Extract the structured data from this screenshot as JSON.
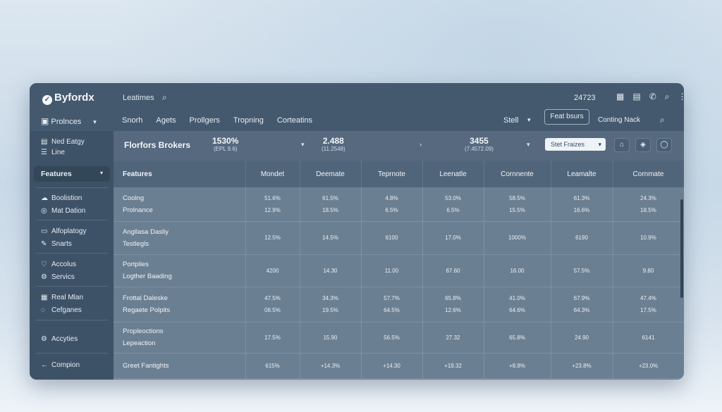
{
  "app": {
    "brand": "Byfordx",
    "search_label": "Leatimes",
    "clock": "24723"
  },
  "nav": {
    "products_label": "Prolnces",
    "tabs": [
      "Snorh",
      "Agets",
      "Prollgers",
      "Tropning",
      "Corteatins"
    ],
    "stell_label": "Stell",
    "features_button": "Feat bsurs",
    "coming_label": "Conting Nack"
  },
  "sidebar": {
    "items_top": [
      "Ned Eatgy",
      "Line"
    ],
    "active": "Features",
    "groups": [
      [
        "Boolistion",
        "Mat Dation"
      ],
      [
        "Alfoplatogy",
        "Snarts"
      ],
      [
        "Accolus",
        "Servics"
      ],
      [
        "Real Mlan",
        "Cefganes"
      ],
      [
        "Accyties"
      ]
    ],
    "footer": "Compion"
  },
  "summary": {
    "title": "Florfors Brokers",
    "stats": [
      {
        "value": "1530%",
        "sub": "(EPL 9.6)"
      },
      {
        "value": "2.488",
        "sub": "(11.2548)"
      },
      {
        "value": "3455",
        "sub": "(7.4572.09)"
      }
    ],
    "select_label": "Stet Fraizes"
  },
  "table": {
    "header_first": "Features",
    "columns": [
      "Mondet",
      "Deemate",
      "Teprnote",
      "Leenatle",
      "Cornnente",
      "Leamalte",
      "Cornmate"
    ],
    "rows": [
      {
        "labels": [
          "Coolng",
          "Prolnance"
        ],
        "values": [
          [
            "51.6%",
            "12.9%"
          ],
          [
            "61.5%",
            "18.5%"
          ],
          [
            "4.8%",
            "6.5%"
          ],
          [
            "53.0%",
            "6.5%"
          ],
          [
            "58.5%",
            "15.5%"
          ],
          [
            "61.3%",
            "16.6%"
          ],
          [
            "24.3%",
            "18.5%"
          ]
        ]
      },
      {
        "labels": [
          "Angllasa Dasliy",
          "Testlegls"
        ],
        "values": [
          [
            "12.5%"
          ],
          [
            "14.5%"
          ],
          [
            "6100"
          ],
          [
            "17.0%"
          ],
          [
            "1000%"
          ],
          [
            "6190"
          ],
          [
            "10.9%"
          ]
        ]
      },
      {
        "labels": [
          "Portplies",
          "Logther Baading"
        ],
        "values": [
          [
            "4200"
          ],
          [
            "14.30"
          ],
          [
            "11.00"
          ],
          [
            "67.60"
          ],
          [
            "16.00"
          ],
          [
            "57.5%"
          ],
          [
            "9.80"
          ]
        ]
      },
      {
        "labels": [
          "Frottal Daleske",
          "Regaete Polpits"
        ],
        "values": [
          [
            "47.5%",
            "06.5%"
          ],
          [
            "34.3%",
            "19.5%"
          ],
          [
            "57.7%",
            "64.5%"
          ],
          [
            "65.8%",
            "12.6%"
          ],
          [
            "41.0%",
            "64.6%"
          ],
          [
            "67.9%",
            "64.3%"
          ],
          [
            "47.4%",
            "17.5%"
          ]
        ]
      },
      {
        "labels": [
          "Propleoctions",
          "Lepeaction"
        ],
        "values": [
          [
            "17.5%"
          ],
          [
            "15.90"
          ],
          [
            "56.5%"
          ],
          [
            "27.32"
          ],
          [
            "65.8%"
          ],
          [
            "24.90"
          ],
          [
            "6141"
          ]
        ]
      },
      {
        "labels": [
          "Greet Fantights"
        ],
        "values": [
          [
            "615%"
          ],
          [
            "+14.3%"
          ],
          [
            "+14.30"
          ],
          [
            "+19.32"
          ],
          [
            "+8.8%"
          ],
          [
            "+23.8%"
          ],
          [
            "+23.0%"
          ]
        ]
      }
    ]
  }
}
